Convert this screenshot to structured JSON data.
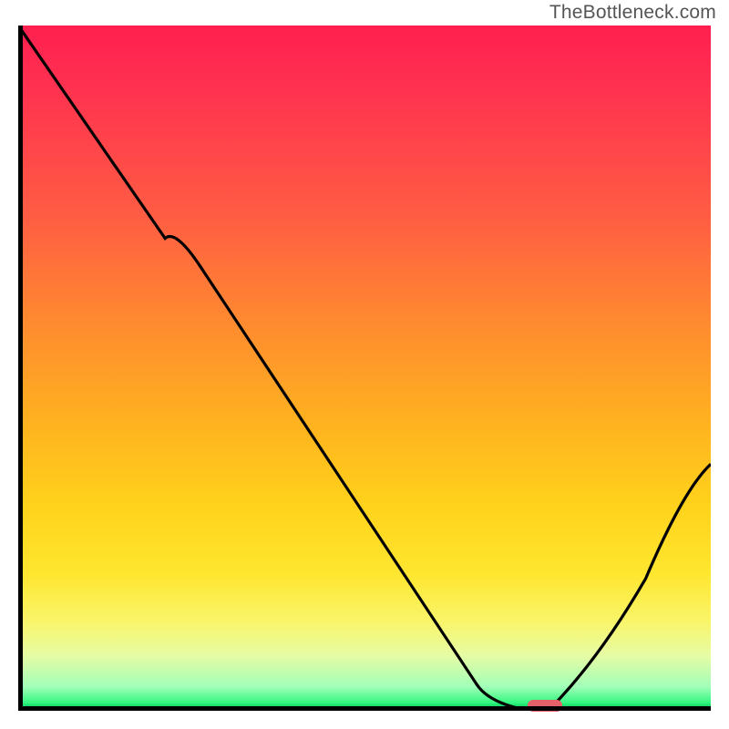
{
  "watermark": "TheBottleneck.com",
  "chart_data": {
    "type": "line",
    "title": "",
    "xlabel": "",
    "ylabel": "",
    "xlim": [
      0,
      100
    ],
    "ylim": [
      0,
      100
    ],
    "series": [
      {
        "name": "bottleneck-curve",
        "x": [
          0,
          22,
          25,
          68,
          74,
          76.5,
          100
        ],
        "y": [
          100,
          70,
          66,
          1,
          0,
          0,
          36
        ]
      }
    ],
    "marker": {
      "x_range": [
        73.5,
        78.5
      ],
      "y": 0.7
    },
    "background_gradient": [
      "#ff1f4f",
      "#ffb21f",
      "#ffe62f",
      "#18e36b"
    ]
  }
}
